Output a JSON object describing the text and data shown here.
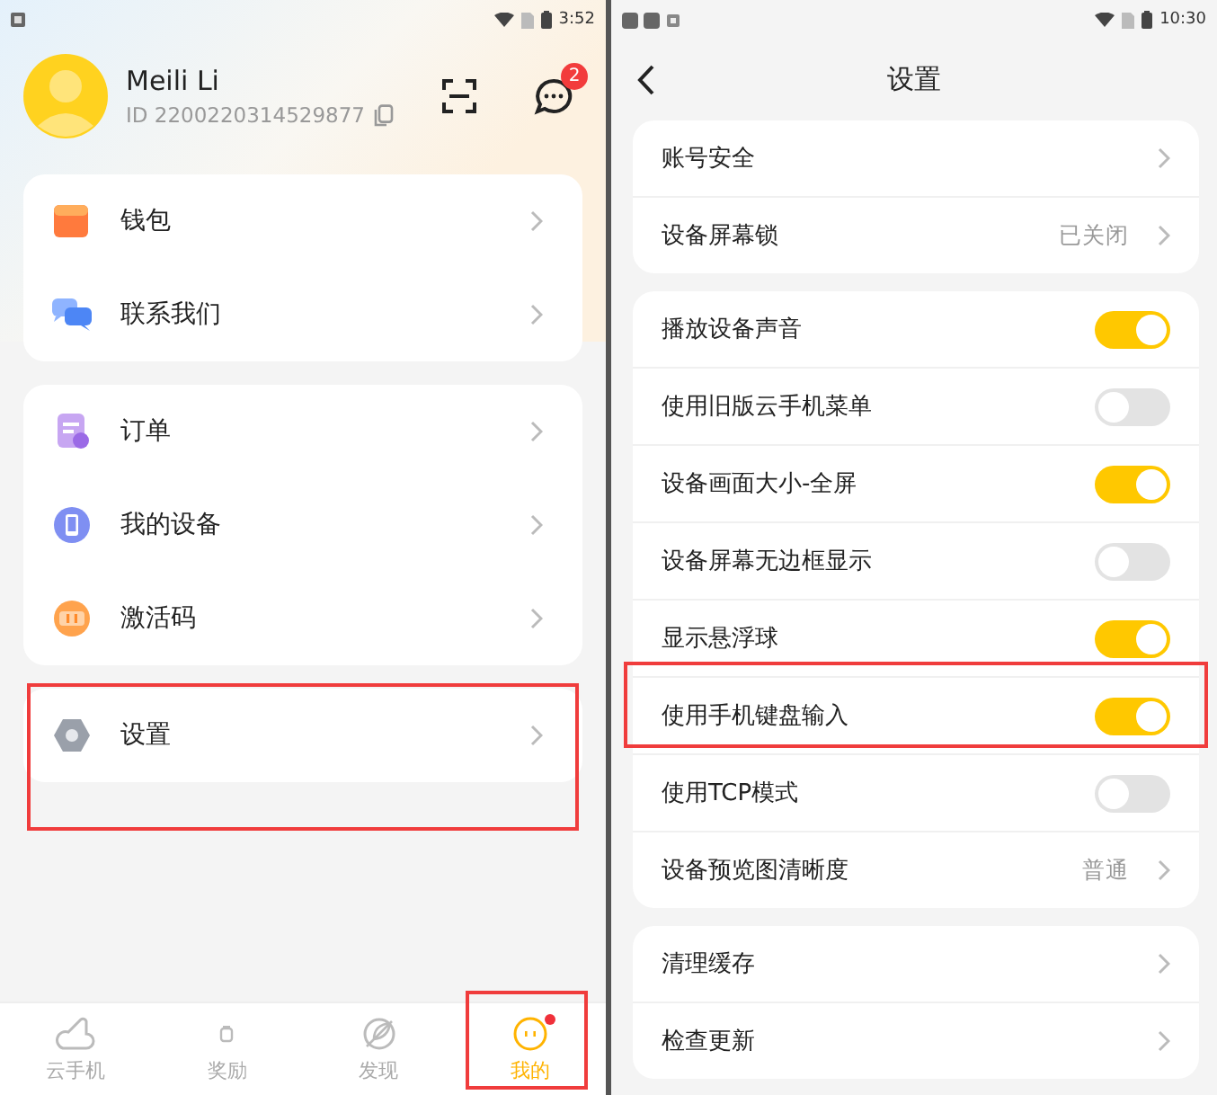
{
  "left": {
    "status_bar": {
      "time": "3:52"
    },
    "profile": {
      "name": "Meili Li",
      "id": "ID 2200220314529877",
      "message_badge": "2"
    },
    "menu_groups": [
      [
        {
          "label": "钱包"
        },
        {
          "label": "联系我们"
        }
      ],
      [
        {
          "label": "订单"
        },
        {
          "label": "我的设备"
        },
        {
          "label": "激活码"
        }
      ],
      [
        {
          "label": "设置"
        }
      ]
    ],
    "nav": [
      {
        "label": "云手机",
        "selected": false,
        "dot": false
      },
      {
        "label": "奖励",
        "selected": false,
        "dot": false
      },
      {
        "label": "发现",
        "selected": false,
        "dot": false
      },
      {
        "label": "我的",
        "selected": true,
        "dot": true
      }
    ]
  },
  "right": {
    "status_bar": {
      "time": "10:30"
    },
    "title": "设置",
    "groups": [
      [
        {
          "kind": "link",
          "label": "账号安全"
        },
        {
          "kind": "link",
          "label": "设备屏幕锁",
          "value": "已关闭"
        }
      ],
      [
        {
          "kind": "switch",
          "label": "播放设备声音",
          "on": true
        },
        {
          "kind": "switch",
          "label": "使用旧版云手机菜单",
          "on": false
        },
        {
          "kind": "switch",
          "label": "设备画面大小-全屏",
          "on": true
        },
        {
          "kind": "switch",
          "label": "设备屏幕无边框显示",
          "on": false
        },
        {
          "kind": "switch",
          "label": "显示悬浮球",
          "on": true
        },
        {
          "kind": "switch",
          "label": "使用手机键盘输入",
          "on": true
        },
        {
          "kind": "switch",
          "label": "使用TCP模式",
          "on": false
        },
        {
          "kind": "link",
          "label": "设备预览图清晰度",
          "value": "普通"
        }
      ],
      [
        {
          "kind": "link",
          "label": "清理缓存"
        },
        {
          "kind": "link",
          "label": "检查更新"
        }
      ]
    ]
  }
}
